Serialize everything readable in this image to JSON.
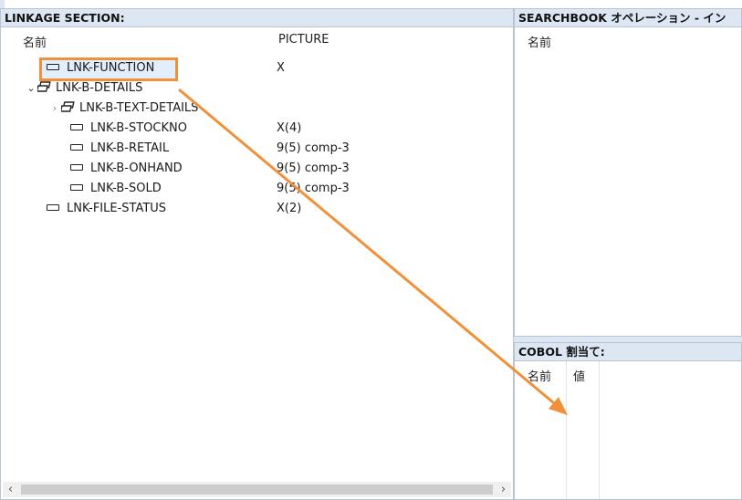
{
  "linkage": {
    "title": "LINKAGE SECTION:",
    "col_name": "名前",
    "col_picture": "PICTURE",
    "rows": [
      {
        "name": "LNK-FUNCTION",
        "picture": "X",
        "icon": "field-icon",
        "level": 1,
        "selected": true
      },
      {
        "name": "LNK-B-DETAILS",
        "picture": "",
        "icon": "group-icon",
        "level": 0,
        "expander": "chevron-down-icon"
      },
      {
        "name": "LNK-B-TEXT-DETAILS",
        "picture": "",
        "icon": "group-icon",
        "level": 1,
        "expander": "chevron-right-icon"
      },
      {
        "name": "LNK-B-STOCKNO",
        "picture": "X(4)",
        "icon": "field-icon",
        "level": 2
      },
      {
        "name": "LNK-B-RETAIL",
        "picture": "9(5) comp-3",
        "icon": "field-icon",
        "level": 2
      },
      {
        "name": "LNK-B-ONHAND",
        "picture": "9(5) comp-3",
        "icon": "field-icon",
        "level": 2
      },
      {
        "name": "LNK-B-SOLD",
        "picture": "9(5) comp-3",
        "icon": "field-icon",
        "level": 2
      },
      {
        "name": "LNK-FILE-STATUS",
        "picture": "X(2)",
        "icon": "field-icon",
        "level": 1
      }
    ]
  },
  "search": {
    "title": "SEARCHBOOK オペレーション - イン",
    "col_name": "名前"
  },
  "assign": {
    "title": "COBOL 割当て:",
    "col_name": "名前",
    "col_value": "値"
  },
  "colors": {
    "header_bg": "#dde6f3",
    "selection_bg": "#e2eefc",
    "callout": "#f0913a"
  }
}
